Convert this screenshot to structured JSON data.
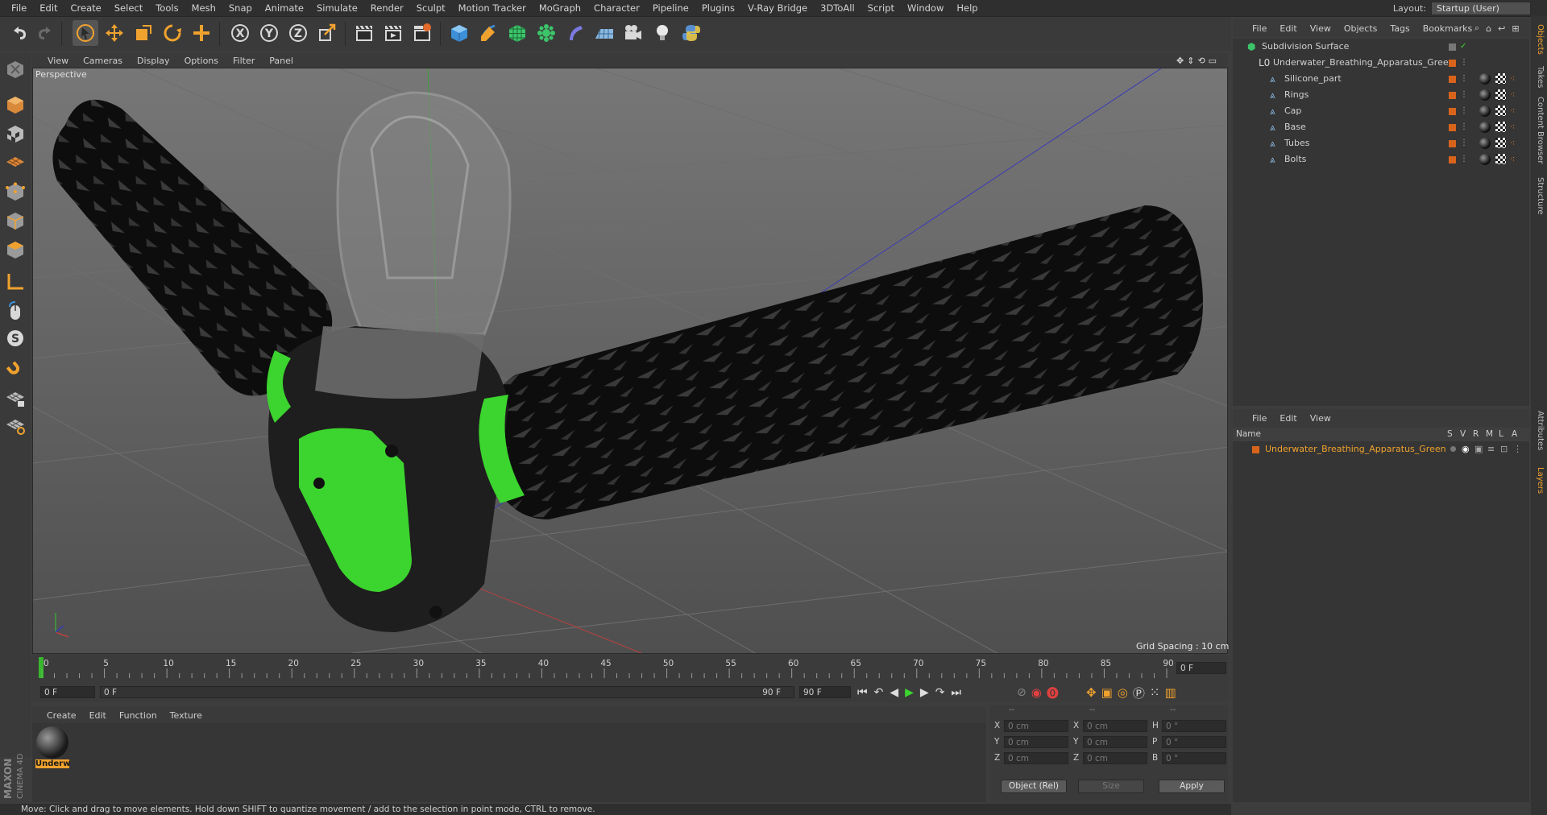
{
  "menu": [
    "File",
    "Edit",
    "Create",
    "Select",
    "Tools",
    "Mesh",
    "Snap",
    "Animate",
    "Simulate",
    "Render",
    "Sculpt",
    "Motion Tracker",
    "MoGraph",
    "Character",
    "Pipeline",
    "Plugins",
    "V-Ray Bridge",
    "3DToAll",
    "Script",
    "Window",
    "Help"
  ],
  "layout": {
    "label": "Layout:",
    "value": "Startup (User)"
  },
  "toolbar_axes": [
    "X",
    "Y",
    "Z"
  ],
  "viewport": {
    "menu": [
      "View",
      "Cameras",
      "Display",
      "Options",
      "Filter",
      "Panel"
    ],
    "label": "Perspective",
    "grid_spacing": "Grid Spacing : 10 cm"
  },
  "timeline": {
    "ticks": [
      "0",
      "5",
      "10",
      "15",
      "20",
      "25",
      "30",
      "35",
      "40",
      "45",
      "50",
      "55",
      "60",
      "65",
      "70",
      "75",
      "80",
      "85",
      "90"
    ],
    "current_frame": "0 F",
    "start": "0 F",
    "range_start": "0 F",
    "range_end": "90 F",
    "end": "90 F"
  },
  "materials": {
    "menu": [
      "Create",
      "Edit",
      "Function",
      "Texture"
    ],
    "items": [
      {
        "label": "Underw"
      }
    ]
  },
  "coords": {
    "headers": [
      "--",
      "--",
      "--"
    ],
    "rows": [
      {
        "a": "X",
        "av": "0 cm",
        "b": "X",
        "bv": "0 cm",
        "c": "H",
        "cv": "0 °"
      },
      {
        "a": "Y",
        "av": "0 cm",
        "b": "Y",
        "bv": "0 cm",
        "c": "P",
        "cv": "0 °"
      },
      {
        "a": "Z",
        "av": "0 cm",
        "b": "Z",
        "bv": "0 cm",
        "c": "B",
        "cv": "0 °"
      }
    ],
    "mode": "Object (Rel)",
    "size": "Size",
    "apply": "Apply"
  },
  "status": "Move: Click and drag to move elements. Hold down SHIFT to quantize movement / add to the selection in point mode, CTRL to remove.",
  "objects": {
    "menu": [
      "File",
      "Edit",
      "View",
      "Objects",
      "Tags",
      "Bookmarks"
    ],
    "tree": [
      {
        "name": "Subdivision Surface",
        "level": 0
      },
      {
        "name": "Underwater_Breathing_Apparatus_Green",
        "level": 1
      },
      {
        "name": "Silicone_part",
        "level": 2
      },
      {
        "name": "Rings",
        "level": 2
      },
      {
        "name": "Cap",
        "level": 2
      },
      {
        "name": "Base",
        "level": 2
      },
      {
        "name": "Tubes",
        "level": 2
      },
      {
        "name": "Bolts",
        "level": 2
      }
    ]
  },
  "layers": {
    "menu": [
      "File",
      "Edit",
      "View"
    ],
    "columns": {
      "name": "Name",
      "s": "S",
      "v": "V",
      "r": "R",
      "m": "M",
      "l": "L",
      "a": "A"
    },
    "items": [
      {
        "name": "Underwater_Breathing_Apparatus_Green"
      }
    ]
  },
  "side_tabs": [
    "Objects",
    "Takes",
    "Content Browser",
    "Structure",
    "Attributes",
    "Layers"
  ],
  "brand": {
    "line1": "MAXON",
    "line2": "CINEMA 4D"
  },
  "colors": {
    "accent": "#f0a22e",
    "green": "#3cd42e",
    "orange": "#d8641c"
  }
}
